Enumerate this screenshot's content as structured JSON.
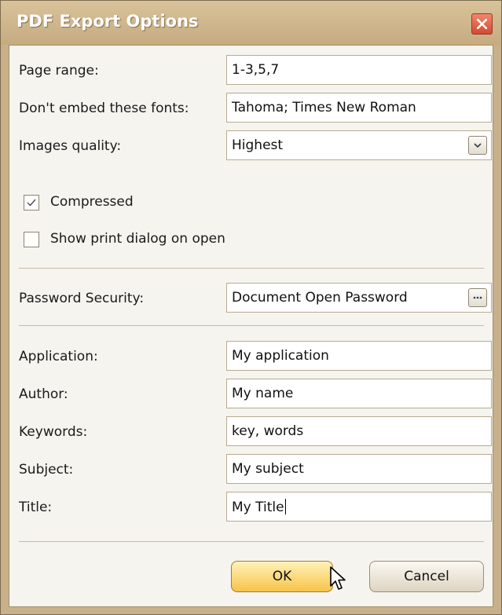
{
  "dialog": {
    "title": "PDF Export Options"
  },
  "fields": {
    "page_range": {
      "label": "Page range:",
      "value": "1-3,5,7"
    },
    "no_embed_fonts": {
      "label": "Don't embed these fonts:",
      "value": "Tahoma; Times New Roman"
    },
    "images_quality": {
      "label": "Images quality:",
      "value": "Highest"
    }
  },
  "options": {
    "compressed": {
      "label": "Compressed",
      "checked": true
    },
    "show_print_dialog": {
      "label": "Show print dialog on open",
      "checked": false
    }
  },
  "security": {
    "label": "Password Security:",
    "value": "Document Open Password"
  },
  "document_info": {
    "application": {
      "label": "Application:",
      "value": "My application"
    },
    "author": {
      "label": "Author:",
      "value": "My name"
    },
    "keywords": {
      "label": "Keywords:",
      "value": "key, words"
    },
    "subject": {
      "label": "Subject:",
      "value": "My subject"
    },
    "title": {
      "label": "Title:",
      "value": "My Title"
    }
  },
  "buttons": {
    "ok": "OK",
    "cancel": "Cancel"
  },
  "icons": {
    "close": "close-icon",
    "dropdown": "chevron-down-icon",
    "ellipsis": "ellipsis-icon",
    "check": "checkmark-icon",
    "cursor": "mouse-pointer-icon"
  }
}
